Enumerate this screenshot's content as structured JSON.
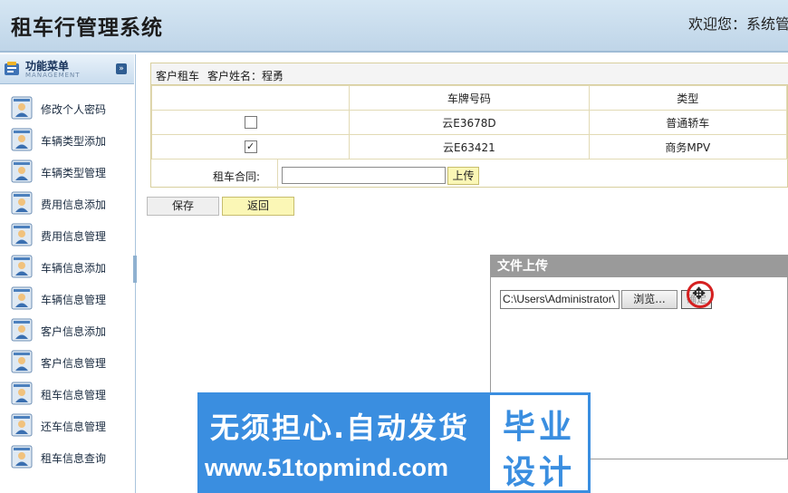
{
  "header": {
    "title": "租车行管理系统",
    "welcome": "欢迎您：系统管"
  },
  "sidebar": {
    "heading": "功能菜单",
    "heading_sub": "MANAGEMENT",
    "collapse_icon": "chevron-down-icon",
    "items": [
      {
        "label": "修改个人密码",
        "icon": "user-card-icon"
      },
      {
        "label": "车辆类型添加",
        "icon": "user-card-icon"
      },
      {
        "label": "车辆类型管理",
        "icon": "user-card-icon"
      },
      {
        "label": "费用信息添加",
        "icon": "user-card-icon"
      },
      {
        "label": "费用信息管理",
        "icon": "user-card-icon"
      },
      {
        "label": "车辆信息添加",
        "icon": "user-card-icon"
      },
      {
        "label": "车辆信息管理",
        "icon": "user-card-icon"
      },
      {
        "label": "客户信息添加",
        "icon": "user-card-icon"
      },
      {
        "label": "客户信息管理",
        "icon": "user-card-icon"
      },
      {
        "label": "租车信息管理",
        "icon": "user-card-icon"
      },
      {
        "label": "还车信息管理",
        "icon": "user-card-icon"
      },
      {
        "label": "租车信息查询",
        "icon": "user-card-icon"
      }
    ]
  },
  "form": {
    "caption_left": "客户租车",
    "caption_customer": "客户姓名：程勇",
    "columns": [
      "",
      "车牌号码",
      "类型"
    ],
    "rows": [
      {
        "checked": false,
        "check_mark": "",
        "plate": "云E3678D",
        "type": "普通轿车"
      },
      {
        "checked": true,
        "check_mark": "✓",
        "plate": "云E63421",
        "type": "商务MPV"
      }
    ],
    "contract_label": "租车合同:",
    "contract_value": "",
    "upload_label": "上传",
    "save_label": "保存",
    "back_label": "返回"
  },
  "dialog": {
    "title": "文件上传",
    "file_path": "C:\\Users\\Administrator\\",
    "browse_label": "浏览...",
    "ok_label": "确定"
  },
  "watermark": {
    "line1": "无须担心.自动发货",
    "line2": "www.51topmind.com",
    "badge_top": "毕业",
    "badge_bottom": "设计"
  },
  "colors": {
    "header_bg": "#c9dcee",
    "accent_yellow": "#fbf7b6",
    "dialog_title_bg": "#9a9a9a",
    "watermark_blue": "#3a8ee0"
  }
}
